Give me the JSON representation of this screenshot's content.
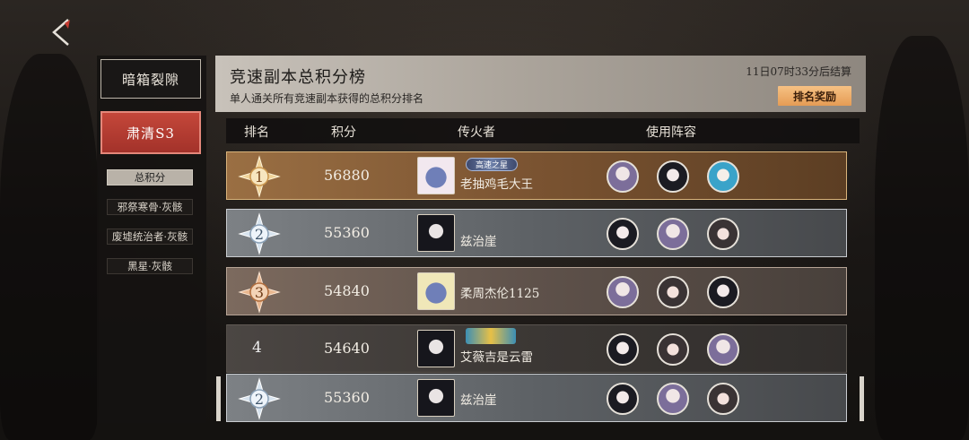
{
  "sidebar": {
    "tab_dark": "暗箱裂隙",
    "tab_red": "肃清S3",
    "sub_items": [
      "总积分",
      "邪祭寒骨·灰骸",
      "废墟统治者·灰骸",
      "黑星·灰骸"
    ]
  },
  "header": {
    "title": "竞速副本总积分榜",
    "subtitle": "单人通关所有竞速副本获得的总积分排名",
    "countdown": "11日07时33分后结算",
    "reward_button": "排名奖励"
  },
  "columns": {
    "rank": "排名",
    "score": "积分",
    "player": "传火者",
    "team": "使用阵容"
  },
  "rows": [
    {
      "rank": "1",
      "score": "56880",
      "name": "老抽鸡毛大王",
      "title_badge": "高速之星",
      "style": "gold"
    },
    {
      "rank": "2",
      "score": "55360",
      "name": "兹治崖",
      "style": "silver"
    },
    {
      "rank": "3",
      "score": "54840",
      "name": "柔周杰伦1125",
      "style": "bronze"
    },
    {
      "rank": "4",
      "score": "54640",
      "name": "艾薇吉是云雷",
      "title_badge": "",
      "style": "plain"
    },
    {
      "rank": "2",
      "score": "55360",
      "name": "兹治崖",
      "style": "silver"
    }
  ],
  "colors": {
    "accent_red": "#b33a30",
    "reward_orange": "#f0ae6a"
  }
}
